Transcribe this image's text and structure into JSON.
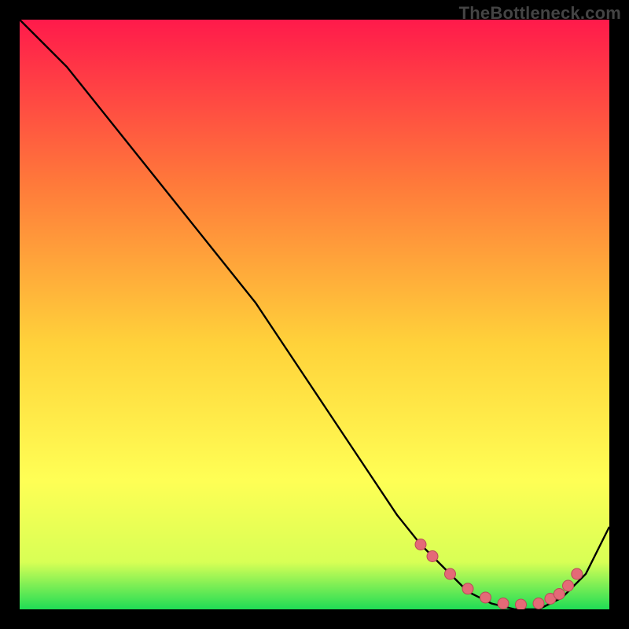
{
  "watermark": "TheBottleneck.com",
  "colors": {
    "bg": "#000000",
    "grad_top": "#ff1a4b",
    "grad_mid1": "#ff7a3a",
    "grad_mid2": "#ffd23a",
    "grad_mid3": "#ffff55",
    "grad_mid4": "#d8ff55",
    "grad_bottom": "#1fdd55",
    "curve": "#000000",
    "marker_fill": "#e46a77",
    "marker_stroke": "#b94a57"
  },
  "chart_data": {
    "type": "line",
    "title": "",
    "xlabel": "",
    "ylabel": "",
    "xlim": [
      0,
      100
    ],
    "ylim": [
      0,
      100
    ],
    "x": [
      0,
      4,
      8,
      12,
      16,
      20,
      24,
      28,
      32,
      36,
      40,
      44,
      48,
      52,
      56,
      60,
      64,
      68,
      72,
      76,
      80,
      84,
      88,
      92,
      96,
      100
    ],
    "y": [
      100,
      96,
      92,
      87,
      82,
      77,
      72,
      67,
      62,
      57,
      52,
      46,
      40,
      34,
      28,
      22,
      16,
      11,
      7,
      3,
      1,
      0,
      0,
      2,
      6,
      14
    ],
    "markers_x": [
      68,
      70,
      73,
      76,
      79,
      82,
      85,
      88,
      90,
      91.5,
      93,
      94.5
    ],
    "markers_y": [
      11,
      9,
      6,
      3.5,
      2,
      1,
      0.8,
      1,
      1.8,
      2.6,
      4,
      6
    ]
  }
}
